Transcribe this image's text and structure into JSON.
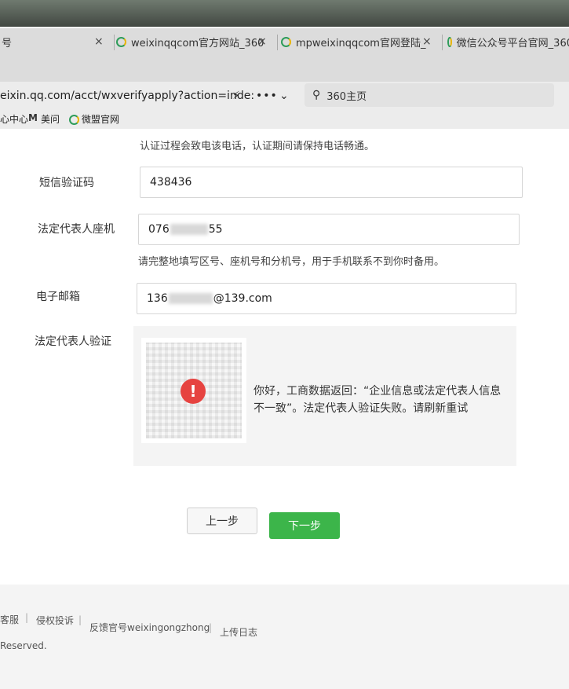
{
  "browser": {
    "tabs": [
      {
        "label": "号"
      },
      {
        "label": "weixinqqcom官方网站_360"
      },
      {
        "label": "mpweixinqqcom官网登陆_"
      },
      {
        "label": "微信公众号平台官网_360"
      }
    ],
    "close_glyph": "×",
    "address": "eixin.qq.com/acct/wxverifyapply?action=inde:",
    "search_placeholder": "360主页",
    "bookmarks": [
      {
        "label": "心中心"
      },
      {
        "label": "美问"
      },
      {
        "label": "微盟官网"
      }
    ]
  },
  "form": {
    "top_note": "认证过程会致电该电话，认证期间请保持电话畅通。",
    "sms_label": "短信验证码",
    "sms_value": "438436",
    "landline_label": "法定代表人座机",
    "landline_prefix": "076",
    "landline_suffix": "55",
    "landline_hint": "请完整地填写区号、座机号和分机号，用于手机联系不到你时备用。",
    "email_label": "电子邮箱",
    "email_prefix": "136",
    "email_suffix": "@139.com",
    "verify_label": "法定代表人验证",
    "verify_message": "你好，工商数据返回：“企业信息或法定代表人信息不一致”。法定代表人验证失败。请刷新重试",
    "warn_glyph": "!",
    "prev_button": "上一步",
    "next_button": "下一步"
  },
  "footer": {
    "links": [
      {
        "label": "客服"
      },
      {
        "label": "侵权投诉"
      },
      {
        "label": "反馈官号weixingongzhong"
      },
      {
        "label": "上传日志"
      }
    ],
    "separator": "|",
    "copyright": "Reserved."
  },
  "colors": {
    "primary": "#3cb54a",
    "warning": "#e64340"
  }
}
